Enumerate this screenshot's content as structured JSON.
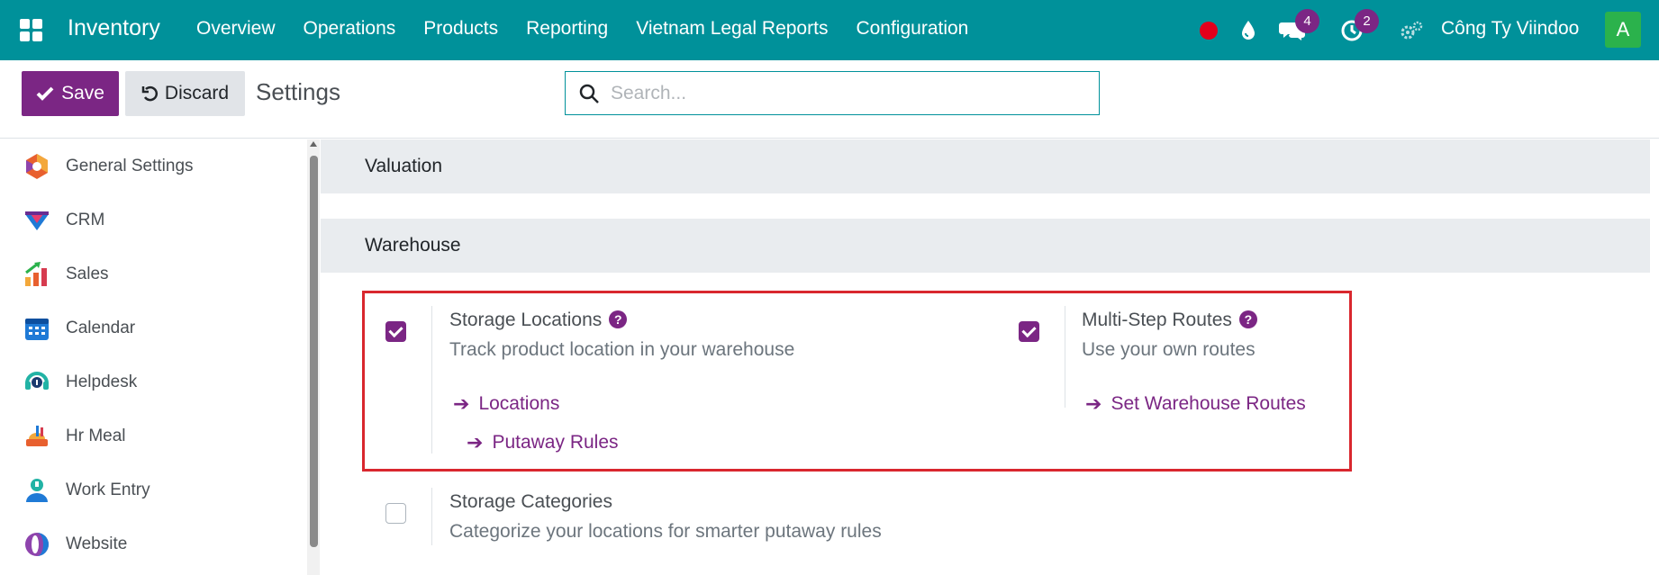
{
  "navbar": {
    "brand": "Inventory",
    "menu": [
      "Overview",
      "Operations",
      "Products",
      "Reporting",
      "Vietnam Legal Reports",
      "Configuration"
    ],
    "chat_count": "4",
    "activity_count": "2",
    "company": "Công Ty Viindoo",
    "avatar_letter": "A"
  },
  "controls": {
    "save_label": "Save",
    "discard_label": "Discard",
    "title": "Settings",
    "search_placeholder": "Search..."
  },
  "sidebar": {
    "items": [
      {
        "label": "General Settings",
        "icon": "general-settings-icon"
      },
      {
        "label": "CRM",
        "icon": "crm-icon"
      },
      {
        "label": "Sales",
        "icon": "sales-icon"
      },
      {
        "label": "Calendar",
        "icon": "calendar-icon"
      },
      {
        "label": "Helpdesk",
        "icon": "helpdesk-icon"
      },
      {
        "label": "Hr Meal",
        "icon": "hr-meal-icon"
      },
      {
        "label": "Work Entry",
        "icon": "work-entry-icon"
      },
      {
        "label": "Website",
        "icon": "website-icon"
      }
    ]
  },
  "sections": {
    "valuation": "Valuation",
    "warehouse": "Warehouse"
  },
  "settings": {
    "storage_locations": {
      "title": "Storage Locations",
      "desc": "Track product location in your warehouse",
      "checked": true,
      "links": [
        "Locations",
        "Putaway Rules"
      ]
    },
    "multi_step_routes": {
      "title": "Multi-Step Routes",
      "desc": "Use your own routes",
      "checked": true,
      "links": [
        "Set Warehouse Routes"
      ]
    },
    "storage_categories": {
      "title": "Storage Categories",
      "desc": "Categorize your locations for smarter putaway rules",
      "checked": false
    }
  },
  "colors": {
    "navbar": "#00919a",
    "primary": "#7b2684",
    "highlight": "#d9272e"
  }
}
